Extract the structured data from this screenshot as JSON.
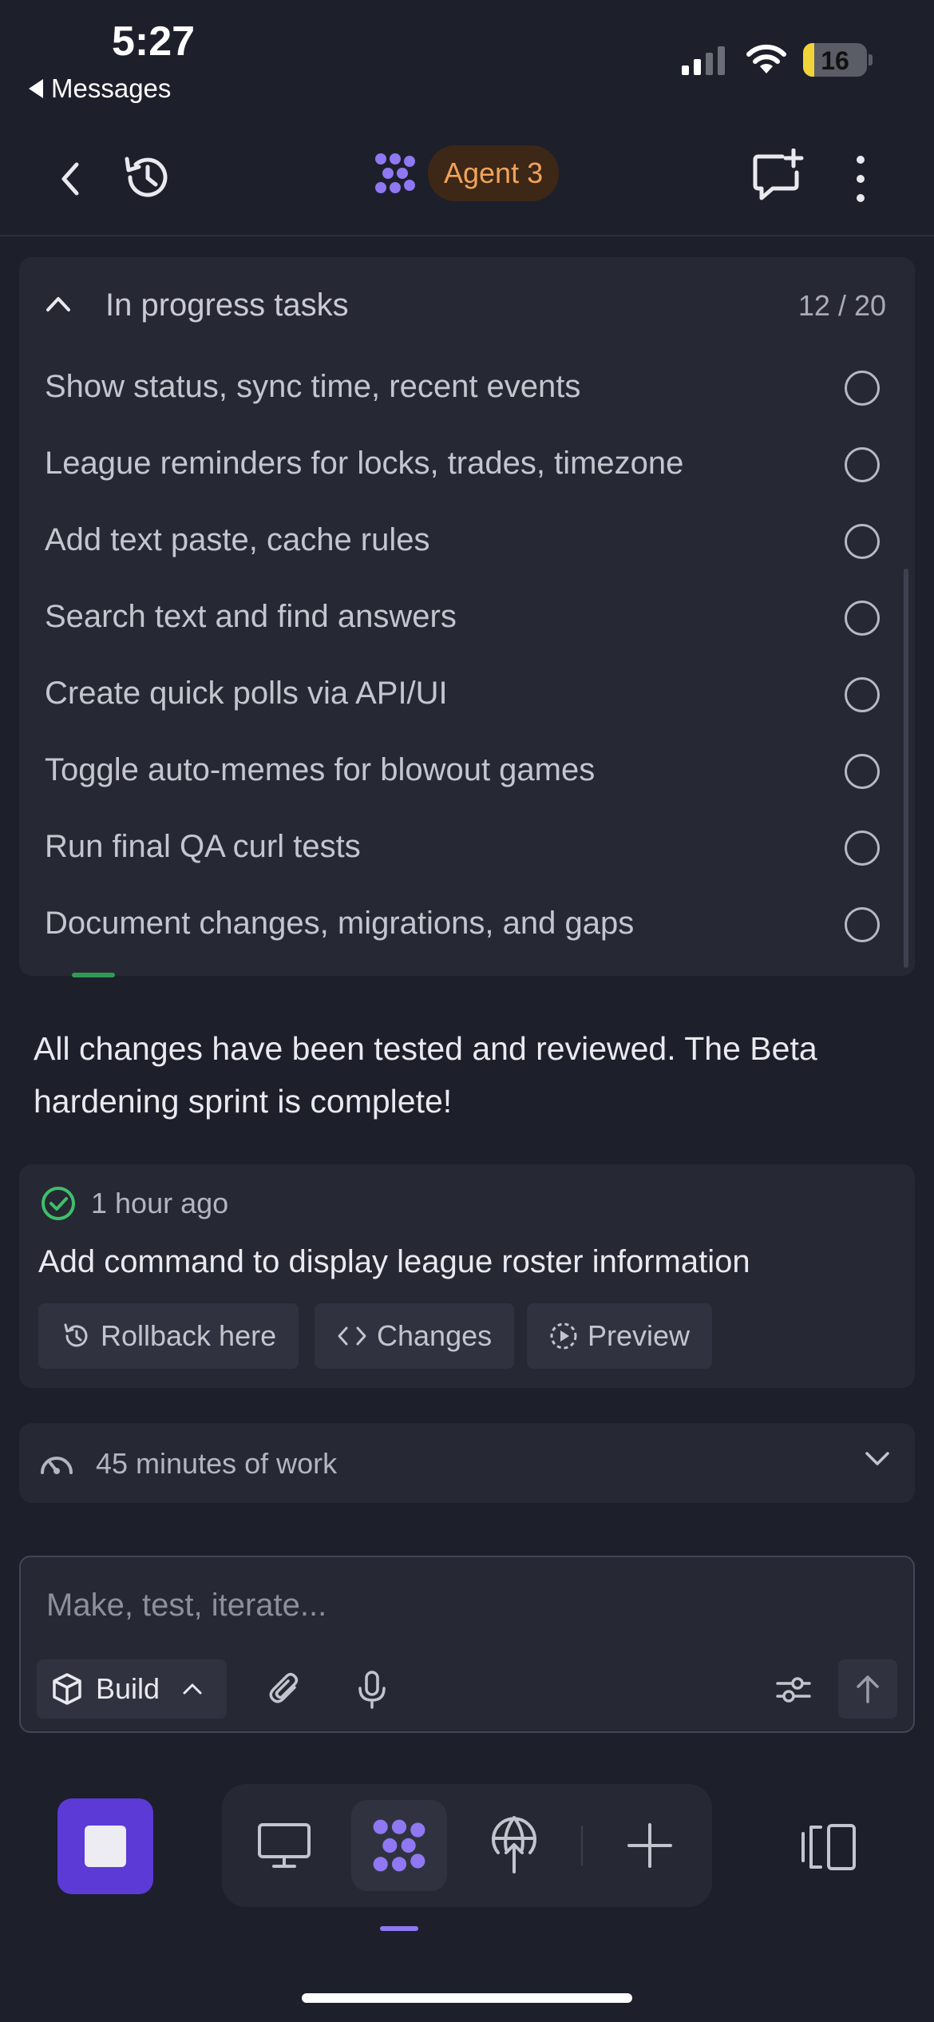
{
  "status_bar": {
    "time": "5:27",
    "back_app": "Messages",
    "battery": "16"
  },
  "header": {
    "agent_name": "Agent 3",
    "accent": "#f0a35b",
    "logo_color": "#8f78f2"
  },
  "tasks": {
    "title": "In progress tasks",
    "count": "12 / 20",
    "items": [
      {
        "label": "Show status, sync time, recent events",
        "done": false
      },
      {
        "label": "League reminders for locks, trades, timezone",
        "done": false
      },
      {
        "label": "Add text paste, cache rules",
        "done": false
      },
      {
        "label": "Search text and find answers",
        "done": false
      },
      {
        "label": "Create quick polls via API/UI",
        "done": false
      },
      {
        "label": "Toggle auto-memes for blowout games",
        "done": false
      },
      {
        "label": "Run final QA curl tests",
        "done": false
      },
      {
        "label": "Document changes, migrations, and gaps",
        "done": false
      }
    ]
  },
  "message": {
    "text": "All changes have been tested and reviewed. The Beta hardening sprint is complete!"
  },
  "checkpoint": {
    "time": "1 hour ago",
    "title": "Add command to display league roster information",
    "rollback_label": "Rollback here",
    "changes_label": "Changes",
    "preview_label": "Preview",
    "status_color": "#3fbf6a"
  },
  "work_summary": {
    "label": "45 minutes of work"
  },
  "composer": {
    "placeholder": "Make, test, iterate...",
    "value": "",
    "mode_label": "Build"
  },
  "nav": {
    "active": "agent",
    "stop_color": "#5b3ad6"
  }
}
